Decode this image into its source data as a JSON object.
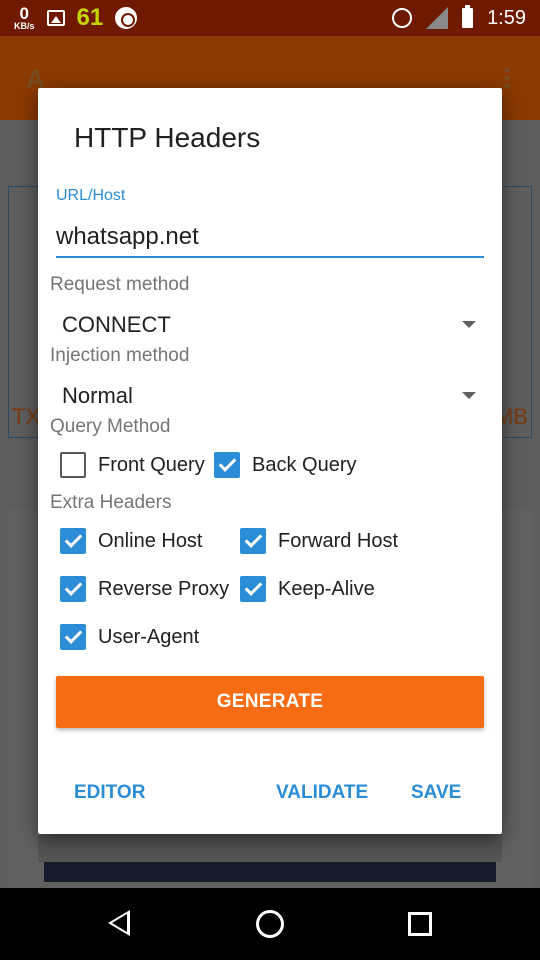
{
  "status_bar": {
    "net_speed_value": "0",
    "net_speed_unit": "KB/s",
    "notification_count": "61",
    "time": "1:59",
    "icons": [
      "image-icon",
      "hotspot-icon",
      "alarm-icon",
      "signal-icon",
      "battery-icon"
    ]
  },
  "background": {
    "app_title_fragment": "A",
    "left_fragment": "TX",
    "right_fragment": "MB"
  },
  "dialog": {
    "title": "HTTP Headers",
    "url_label": "URL/Host",
    "url_value": "whatsapp.net",
    "request_method_label": "Request method",
    "request_method_value": "CONNECT",
    "injection_method_label": "Injection method",
    "injection_method_value": "Normal",
    "query_method_label": "Query Method",
    "query_options": [
      {
        "label": "Front Query",
        "checked": false
      },
      {
        "label": "Back Query",
        "checked": true
      }
    ],
    "extra_headers_label": "Extra Headers",
    "extra_headers": [
      {
        "label": "Online Host",
        "checked": true
      },
      {
        "label": "Forward Host",
        "checked": true
      },
      {
        "label": "Reverse Proxy",
        "checked": true
      },
      {
        "label": "Keep-Alive",
        "checked": true
      },
      {
        "label": "User-Agent",
        "checked": true
      }
    ],
    "generate_label": "GENERATE",
    "actions": {
      "editor": "EDITOR",
      "validate": "VALIDATE",
      "save": "SAVE"
    }
  },
  "colors": {
    "accent": "#2a8dd6",
    "generate": "#f56c14",
    "status_bar": "#6f1a00"
  }
}
